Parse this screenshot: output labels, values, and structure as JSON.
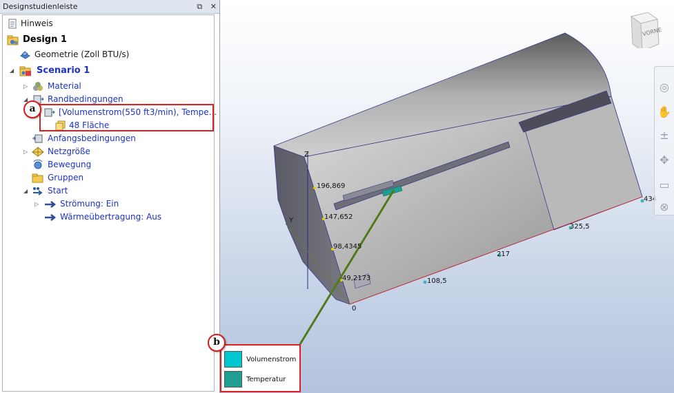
{
  "panel": {
    "title": "Designstudienleiste",
    "pin_glyph": "⧉",
    "close_glyph": "✕"
  },
  "tree": {
    "hint": "Hinweis",
    "design": "Design 1",
    "geometry": "Geometrie (Zoll BTU/s)",
    "scenario": "Scenario 1",
    "material": "Material",
    "boundary": "Randbedingungen",
    "boundary_item": "[Volumenstrom(550 ft3/min), Tempe...",
    "boundary_surface": "48 Fläche",
    "initial": "Anfangsbedingungen",
    "mesh": "Netzgröße",
    "motion": "Bewegung",
    "groups": "Gruppen",
    "start": "Start",
    "flow": "Strömung: Ein",
    "heat": "Wärmeübertragung: Aus"
  },
  "callouts": {
    "a": "a",
    "b": "b"
  },
  "viewcube": {
    "face": "VORNE"
  },
  "dimensions": {
    "z_axis": "Z",
    "y_axis": "Y",
    "z1": "196,869",
    "z2": "147,652",
    "z3": "98,4345",
    "z4": "49,2173",
    "origin": "0",
    "x1": "108,5",
    "x2": "217",
    "x3": "325,5",
    "x4": "434"
  },
  "legend": {
    "items": [
      {
        "label": "Volumenstrom",
        "color": "#00c8d0"
      },
      {
        "label": "Temperatur",
        "color": "#1f9e93"
      }
    ]
  },
  "colors": {
    "blue_text": "#1c33c4",
    "highlight": "#e02020",
    "model_gray": "#9a9a9a"
  }
}
